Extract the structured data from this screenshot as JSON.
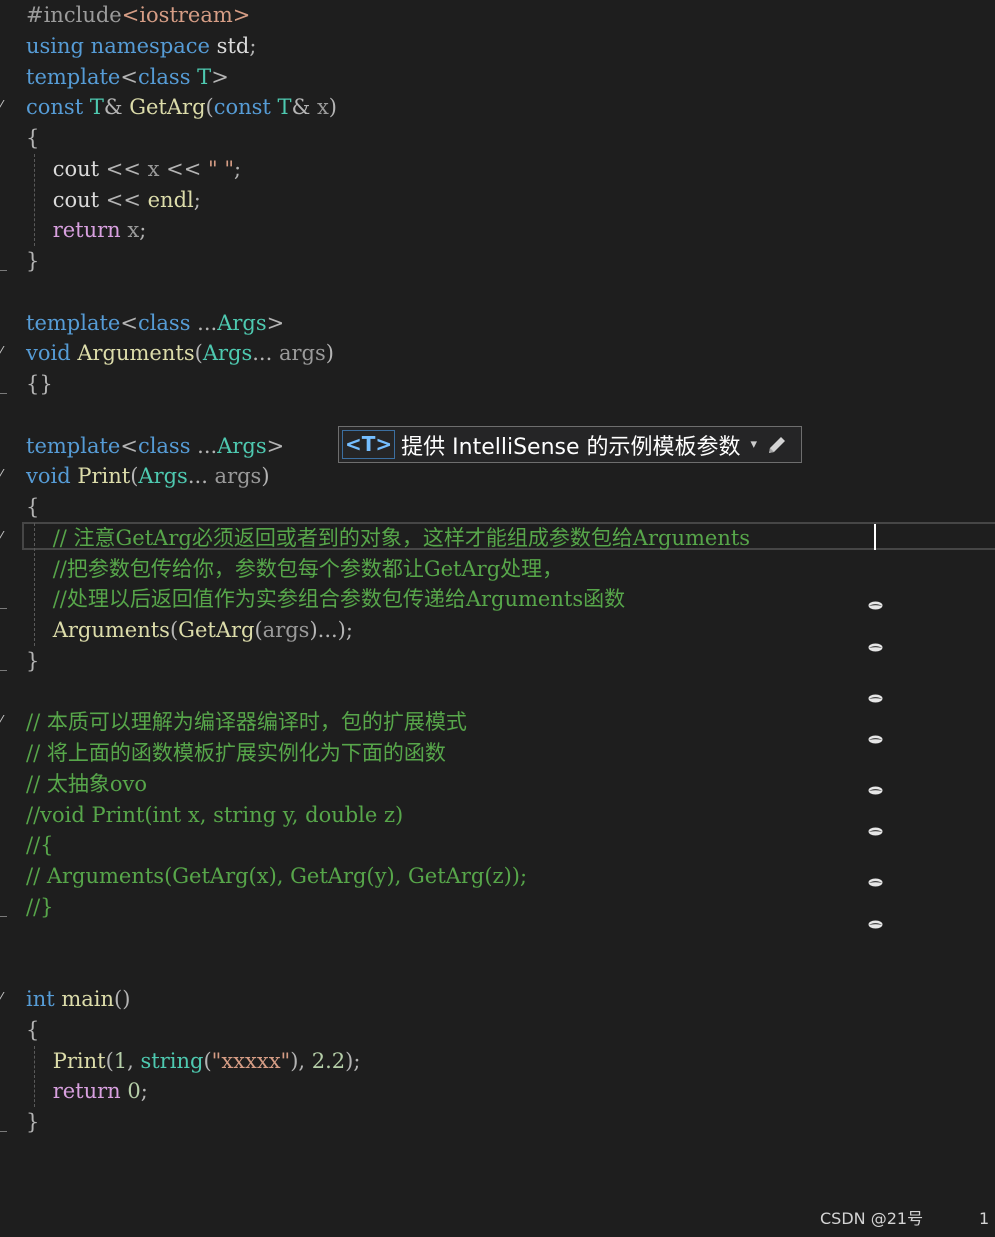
{
  "editor": {
    "code_lines": [
      [
        [
          "#include",
          "pp"
        ],
        [
          "<iostream>",
          "inc"
        ]
      ],
      [
        [
          "using ",
          "kw"
        ],
        [
          "namespace ",
          "kw"
        ],
        [
          "std",
          "id"
        ],
        [
          ";",
          "pu"
        ]
      ],
      [
        [
          "template",
          "kw"
        ],
        [
          "<",
          "pu"
        ],
        [
          "class ",
          "kw"
        ],
        [
          "T",
          "ty"
        ],
        [
          ">",
          "pu"
        ]
      ],
      [
        [
          "const ",
          "kw"
        ],
        [
          "T",
          "ty"
        ],
        [
          "& ",
          "pu"
        ],
        [
          "GetArg",
          "fn"
        ],
        [
          "(",
          "pu"
        ],
        [
          "const ",
          "kw"
        ],
        [
          "T",
          "ty"
        ],
        [
          "& ",
          "pu"
        ],
        [
          "x",
          "par"
        ],
        [
          ")",
          "pu"
        ]
      ],
      [
        [
          "{",
          "pu"
        ]
      ],
      [
        [
          "    cout ",
          "id"
        ],
        [
          "<< ",
          "pu"
        ],
        [
          "x ",
          "par"
        ],
        [
          "<< ",
          "pu"
        ],
        [
          "\" \"",
          "str"
        ],
        [
          ";",
          "pu"
        ]
      ],
      [
        [
          "    cout ",
          "id"
        ],
        [
          "<< ",
          "pu"
        ],
        [
          "endl",
          "fn"
        ],
        [
          ";",
          "pu"
        ]
      ],
      [
        [
          "    ",
          "id"
        ],
        [
          "return ",
          "ctl"
        ],
        [
          "x",
          "par"
        ],
        [
          ";",
          "pu"
        ]
      ],
      [
        [
          "}",
          "pu"
        ]
      ],
      [],
      [
        [
          "template",
          "kw"
        ],
        [
          "<",
          "pu"
        ],
        [
          "class ",
          "kw"
        ],
        [
          "...",
          "pu"
        ],
        [
          "Args",
          "ty"
        ],
        [
          ">",
          "pu"
        ]
      ],
      [
        [
          "void ",
          "kw"
        ],
        [
          "Arguments",
          "fn"
        ],
        [
          "(",
          "pu"
        ],
        [
          "Args",
          "ty"
        ],
        [
          "... ",
          "pu"
        ],
        [
          "args",
          "par"
        ],
        [
          ")",
          "pu"
        ]
      ],
      [
        [
          "{}",
          "pu"
        ]
      ],
      [],
      [
        [
          "template",
          "kw"
        ],
        [
          "<",
          "pu"
        ],
        [
          "class ",
          "kw"
        ],
        [
          "...",
          "pu"
        ],
        [
          "Args",
          "ty"
        ],
        [
          ">",
          "pu"
        ]
      ],
      [
        [
          "void ",
          "kw"
        ],
        [
          "Print",
          "fn"
        ],
        [
          "(",
          "pu"
        ],
        [
          "Args",
          "ty"
        ],
        [
          "... ",
          "pu"
        ],
        [
          "args",
          "par"
        ],
        [
          ")",
          "pu"
        ]
      ],
      [
        [
          "{",
          "pu"
        ]
      ],
      [
        [
          "    ",
          "id"
        ],
        [
          "// 注意GetArg必须返回或者到的对象，这样才能组成参数包给Arguments",
          "cm"
        ]
      ],
      [
        [
          "    ",
          "id"
        ],
        [
          "//把参数包传给你，参数包每个参数都让GetArg处理，",
          "cm"
        ]
      ],
      [
        [
          "    ",
          "id"
        ],
        [
          "//处理以后返回值作为实参组合参数包传递给Arguments函数",
          "cm"
        ]
      ],
      [
        [
          "    ",
          "id"
        ],
        [
          "Arguments",
          "fn"
        ],
        [
          "(",
          "pu"
        ],
        [
          "GetArg",
          "fn"
        ],
        [
          "(",
          "pu"
        ],
        [
          "args",
          "par"
        ],
        [
          ")...);",
          "pu"
        ]
      ],
      [
        [
          "}",
          "pu"
        ]
      ],
      [],
      [
        [
          "// 本质可以理解为编译器编译时，包的扩展模式",
          "cm"
        ]
      ],
      [
        [
          "// 将上面的函数模板扩展实例化为下面的函数",
          "cm"
        ]
      ],
      [
        [
          "// 太抽象ovo",
          "cm"
        ]
      ],
      [
        [
          "//void Print(int x, string y, double z)",
          "cm"
        ]
      ],
      [
        [
          "//{",
          "cm"
        ]
      ],
      [
        [
          "// Arguments(GetArg(x), GetArg(y), GetArg(z));",
          "cm"
        ]
      ],
      [
        [
          "//}",
          "cm"
        ]
      ],
      [],
      [],
      [
        [
          "int ",
          "kw"
        ],
        [
          "main",
          "fn"
        ],
        [
          "()",
          "pu"
        ]
      ],
      [
        [
          "{",
          "pu"
        ]
      ],
      [
        [
          "    ",
          "id"
        ],
        [
          "Print",
          "fn"
        ],
        [
          "(",
          "pu"
        ],
        [
          "1",
          "num"
        ],
        [
          ", ",
          "pu"
        ],
        [
          "string",
          "ty"
        ],
        [
          "(",
          "pu"
        ],
        [
          "\"xxxxx\"",
          "str"
        ],
        [
          "), ",
          "pu"
        ],
        [
          "2.2",
          "num"
        ],
        [
          ");",
          "pu"
        ]
      ],
      [
        [
          "    ",
          "id"
        ],
        [
          "return ",
          "ctl"
        ],
        [
          "0",
          "num"
        ],
        [
          ";",
          "pu"
        ]
      ],
      [
        [
          "}",
          "pu"
        ]
      ]
    ],
    "fold_start_lines": [
      3,
      11,
      15,
      17,
      23,
      32
    ],
    "fold_end_lines": [
      8,
      12,
      19,
      21,
      29,
      36
    ],
    "indent_guides": [
      [
        5,
        7
      ],
      [
        17,
        20
      ],
      [
        34,
        35
      ]
    ],
    "current_line": 17,
    "margin_glyph_count": 8
  },
  "intellisense_hint": {
    "tag": "<T>",
    "text": "提供 IntelliSense 的示例模板参数",
    "chevron": "▾",
    "edit_icon": "pencil-icon"
  },
  "watermark": "CSDN @21号",
  "page_number": "1",
  "colors": {
    "background": "#1e1e1e",
    "keyword": "#569cd6",
    "type": "#4ec9b0",
    "function": "#dcdcaa",
    "comment": "#57a64a",
    "string": "#d69d85",
    "number": "#b5cea8",
    "control": "#d8a0df"
  }
}
